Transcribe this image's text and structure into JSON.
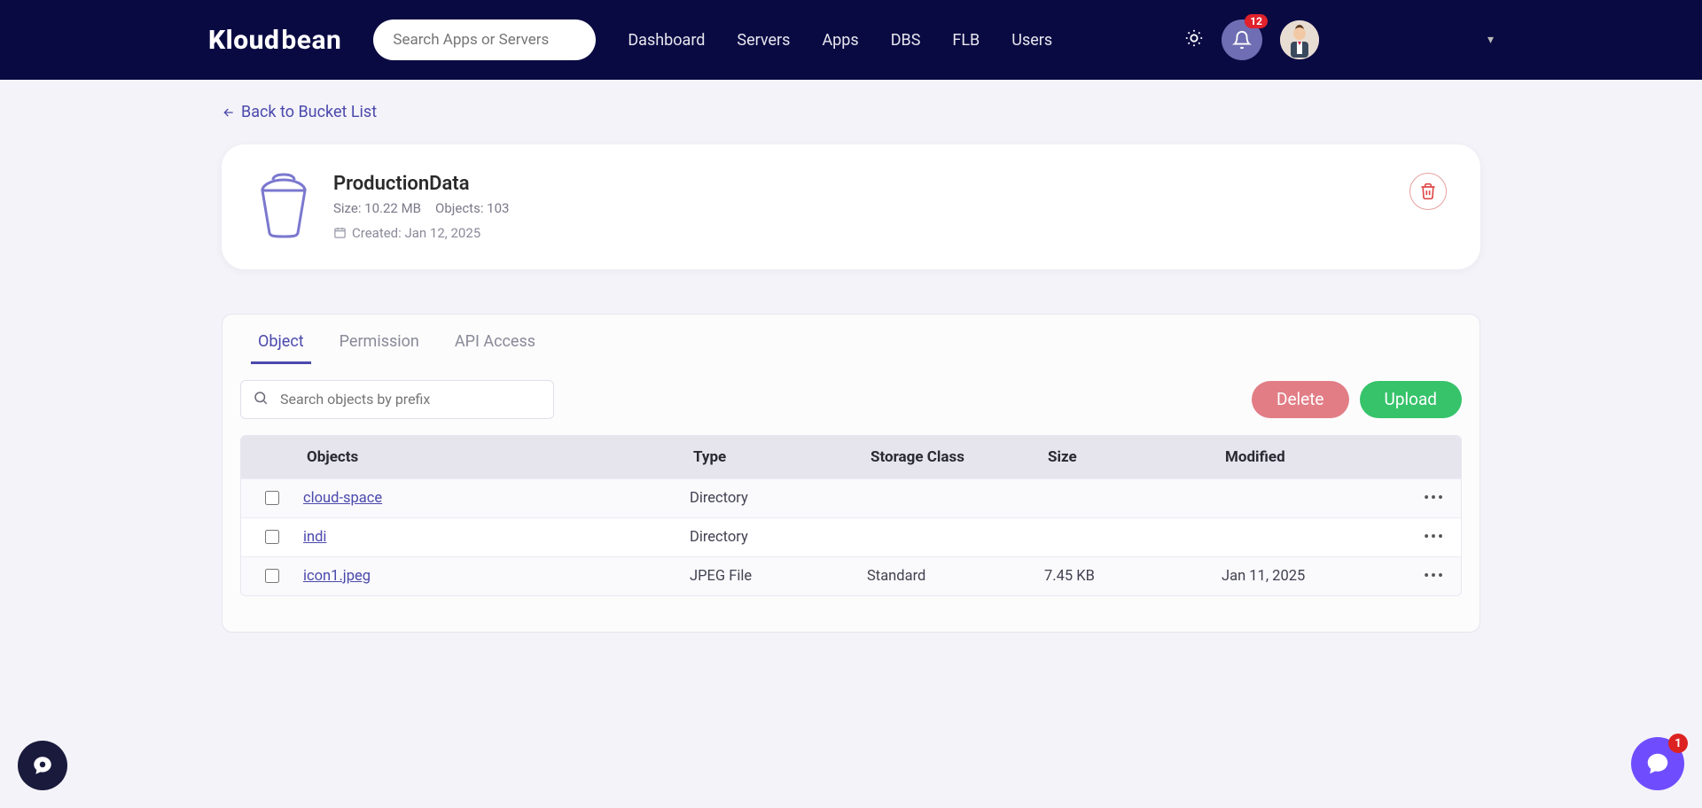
{
  "brand": {
    "name_a": "Kloud",
    "name_b": "bean"
  },
  "search": {
    "placeholder": "Search Apps or Servers"
  },
  "nav": {
    "items": [
      "Dashboard",
      "Servers",
      "Apps",
      "DBS",
      "FLB",
      "Users"
    ]
  },
  "notifications": {
    "count": "12"
  },
  "back": {
    "label": "Back to Bucket List"
  },
  "bucket": {
    "name": "ProductionData",
    "size_label": "Size: 10.22 MB",
    "objects_label": "Objects: 103",
    "created_label": "Created: Jan 12, 2025"
  },
  "tabs": {
    "items": [
      "Object",
      "Permission",
      "API Access"
    ],
    "active": 0
  },
  "objectsearch": {
    "placeholder": "Search objects by prefix"
  },
  "buttons": {
    "delete": "Delete",
    "upload": "Upload"
  },
  "table": {
    "headers": {
      "objects": "Objects",
      "type": "Type",
      "storage": "Storage Class",
      "size": "Size",
      "modified": "Modified"
    },
    "rows": [
      {
        "name": "cloud-space",
        "type": "Directory",
        "storage": "",
        "size": "",
        "modified": ""
      },
      {
        "name": "indi",
        "type": "Directory",
        "storage": "",
        "size": "",
        "modified": ""
      },
      {
        "name": "icon1.jpeg",
        "type": "JPEG File",
        "storage": "Standard",
        "size": "7.45 KB",
        "modified": "Jan 11, 2025"
      }
    ]
  },
  "chat_right": {
    "badge": "1"
  }
}
